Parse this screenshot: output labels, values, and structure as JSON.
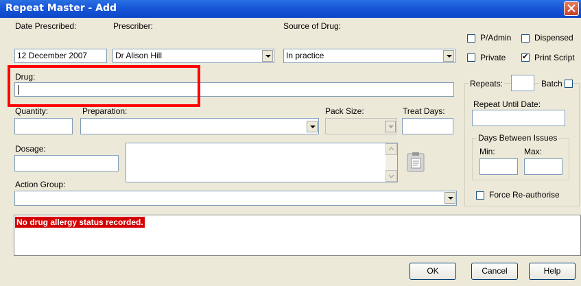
{
  "window": {
    "title": "Repeat Master - Add"
  },
  "date_prescribed": {
    "label": "Date Prescribed:",
    "value": "12 December 2007"
  },
  "prescriber": {
    "label": "Prescriber:",
    "value": "Dr Alison Hill"
  },
  "source_of_drug": {
    "label": "Source of Drug:",
    "value": "In practice"
  },
  "checks": {
    "padmin": {
      "label": "P/Admin",
      "checked": false
    },
    "dispensed": {
      "label": "Dispensed",
      "checked": false
    },
    "private": {
      "label": "Private",
      "checked": false
    },
    "print_script": {
      "label": "Print Script",
      "checked": true
    }
  },
  "drug": {
    "label": "Drug:",
    "value": ""
  },
  "repeats": {
    "label": "Repeats:",
    "value": ""
  },
  "batch": {
    "label": "Batch",
    "checked": false
  },
  "repeat_until": {
    "label": "Repeat Until Date:",
    "value": ""
  },
  "days_between": {
    "title": "Days Between Issues",
    "min_label": "Min:",
    "max_label": "Max:"
  },
  "quantity": {
    "label": "Quantity:"
  },
  "preparation": {
    "label": "Preparation:"
  },
  "pack_size": {
    "label": "Pack Size:"
  },
  "treat_days": {
    "label": "Treat Days:"
  },
  "dosage": {
    "label": "Dosage:"
  },
  "action_group": {
    "label": "Action Group:"
  },
  "force_reauth": {
    "label": "Force Re-authorise",
    "checked": false
  },
  "allergy_message": "No drug allergy status recorded.",
  "buttons": {
    "ok": "OK",
    "cancel": "Cancel",
    "help": "Help"
  },
  "colors": {
    "titlebar": "#1856d8",
    "alert_bg": "#d40000",
    "highlight_box": "#ff0000"
  }
}
